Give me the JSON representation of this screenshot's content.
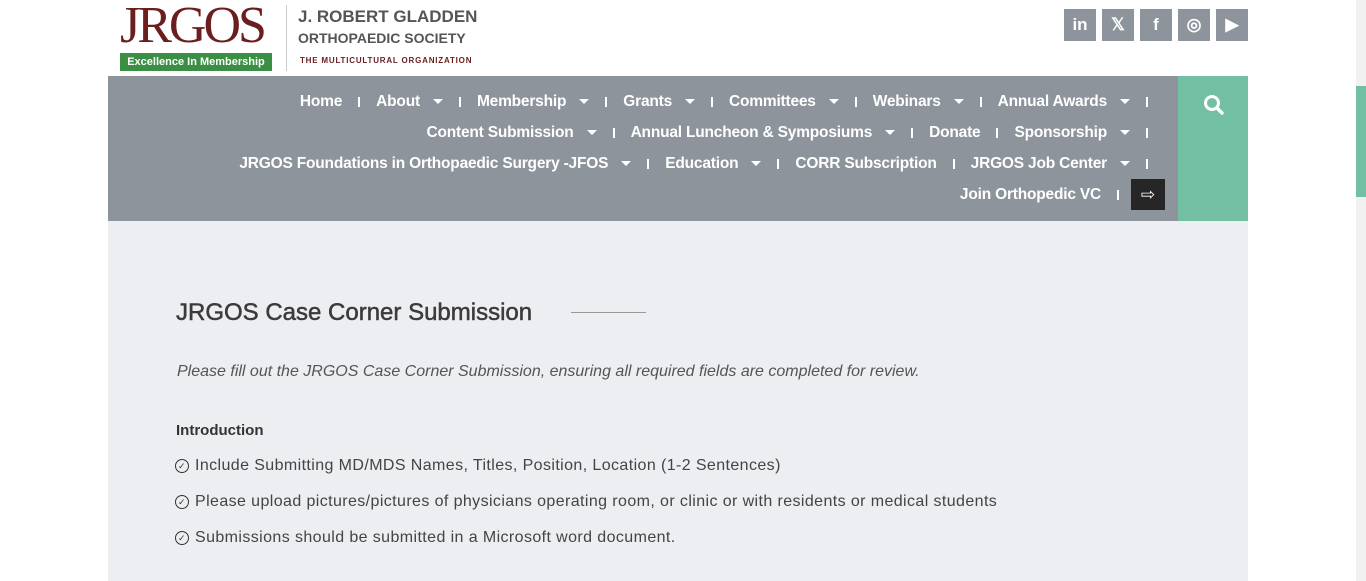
{
  "header": {
    "logo_text": "JRGOS",
    "logo_badge": "Excellence In Membership",
    "org_line1": "J. ROBERT GLADDEN",
    "org_line2": "ORTHOPAEDIC SOCIETY",
    "org_tagline": "THE MULTICULTURAL ORGANIZATION"
  },
  "social": [
    {
      "icon": "linkedin-icon",
      "glyph": "in"
    },
    {
      "icon": "x-twitter-icon",
      "glyph": "𝕏"
    },
    {
      "icon": "facebook-icon",
      "glyph": "f"
    },
    {
      "icon": "instagram-icon",
      "glyph": "◎"
    },
    {
      "icon": "youtube-icon",
      "glyph": "▶"
    }
  ],
  "nav": {
    "rows": [
      [
        {
          "label": "Home",
          "dropdown": false
        },
        {
          "label": "About",
          "dropdown": true
        },
        {
          "label": "Membership",
          "dropdown": true
        },
        {
          "label": "Grants",
          "dropdown": true
        },
        {
          "label": "Committees",
          "dropdown": true
        },
        {
          "label": "Webinars",
          "dropdown": true
        },
        {
          "label": "Annual Awards",
          "dropdown": true
        }
      ],
      [
        {
          "label": "Content Submission",
          "dropdown": true
        },
        {
          "label": "Annual Luncheon & Symposiums",
          "dropdown": true
        },
        {
          "label": "Donate",
          "dropdown": false
        },
        {
          "label": "Sponsorship",
          "dropdown": true
        }
      ],
      [
        {
          "label": "JRGOS Foundations in Orthopaedic Surgery -JFOS",
          "dropdown": true
        },
        {
          "label": "Education",
          "dropdown": true
        },
        {
          "label": "CORR Subscription",
          "dropdown": false
        },
        {
          "label": "JRGOS Job Center",
          "dropdown": true
        }
      ],
      [
        {
          "label": "Join Orthopedic VC",
          "dropdown": false
        }
      ]
    ],
    "logout_glyph": "⇨",
    "search_glyph": "⚲"
  },
  "main": {
    "title": "JRGOS Case Corner Submission",
    "intro": "Please fill out the JRGOS Case Corner Submission, ensuring all required fields are completed for review.",
    "section": "Introduction",
    "items": [
      "Include Submitting MD/MDS Names, Titles, Position, Location (1-2 Sentences)",
      "Please upload pictures/pictures of physicians operating room, or clinic or with residents or medical students",
      "Submissions should be submitted in a Microsoft word document."
    ]
  }
}
